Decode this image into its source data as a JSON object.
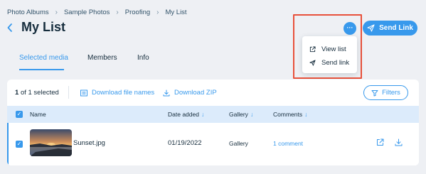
{
  "breadcrumb": [
    "Photo Albums",
    "Sample Photos",
    "Proofing",
    "My List"
  ],
  "page": {
    "title": "My List"
  },
  "header": {
    "more_label": "···",
    "send_link_label": "Send Link"
  },
  "menu": {
    "items": [
      {
        "label": "View list",
        "icon": "external-link-icon"
      },
      {
        "label": "Send link",
        "icon": "send-icon"
      }
    ]
  },
  "tabs": [
    {
      "label": "Selected media",
      "active": true
    },
    {
      "label": "Members",
      "active": false
    },
    {
      "label": "Info",
      "active": false
    }
  ],
  "toolbar": {
    "selected_count": "1",
    "selected_suffix": "of 1 selected",
    "download_names_label": "Download file names",
    "download_zip_label": "Download ZIP",
    "filters_label": "Filters"
  },
  "table": {
    "columns": [
      {
        "label": "Name",
        "sortable": false
      },
      {
        "label": "Date added",
        "sortable": true
      },
      {
        "label": "Gallery",
        "sortable": true
      },
      {
        "label": "Comments",
        "sortable": true
      }
    ],
    "rows": [
      {
        "name": "Sunset.jpg",
        "date_added": "01/19/2022",
        "gallery": "Gallery",
        "comments": "1 comment",
        "checked": true
      }
    ]
  },
  "colors": {
    "accent": "#3899ec",
    "highlight": "#e8513b",
    "header_bg": "#dcebfb",
    "page_bg": "#eef0f4"
  }
}
